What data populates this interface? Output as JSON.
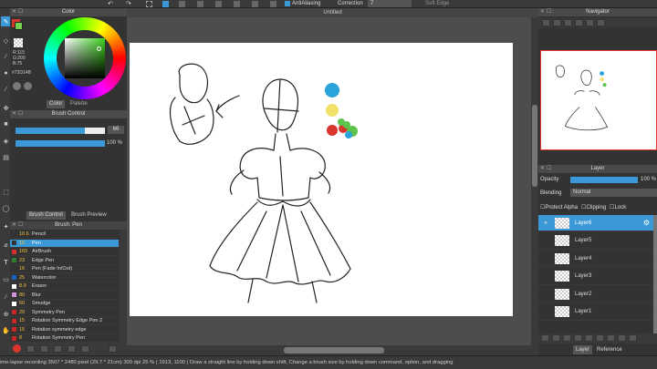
{
  "topbar": {
    "antialiasing": "AntiAliasing",
    "correction": "Correction",
    "correction_value": "7",
    "soft_edge": "Soft Edge"
  },
  "canvas": {
    "title": "Untitled"
  },
  "color_panel": {
    "title": "Color",
    "r": "R:115",
    "g": "G:209",
    "b": "B:75",
    "hex": "#73D14B",
    "tab_color": "Color",
    "tab_palette": "Palette"
  },
  "brush_control": {
    "title": "Brush Control",
    "size": "66",
    "opacity": "100 %",
    "tab1": "Brush Control",
    "tab2": "Brush Preview"
  },
  "brush_list": {
    "title": "Brush: Pen",
    "items": [
      {
        "size": "10.6",
        "name": "Pencil",
        "color": "#333333"
      },
      {
        "size": "10",
        "name": "Pen",
        "color": "#333333"
      },
      {
        "size": "165",
        "name": "AirBrush",
        "color": "#d32f2f"
      },
      {
        "size": "23",
        "name": "Edge Pen",
        "color": "#2e7d32"
      },
      {
        "size": "16",
        "name": "Pen (Fade In/Out)",
        "color": "#333333"
      },
      {
        "size": "25",
        "name": "Watercolor",
        "color": "#1565c0"
      },
      {
        "size": "8.9",
        "name": "Eraser",
        "color": "#ffffff"
      },
      {
        "size": "80",
        "name": "Blur",
        "color": "#ce93d8"
      },
      {
        "size": "50",
        "name": "Smudge",
        "color": "#ffffff"
      },
      {
        "size": "29",
        "name": "Symmetry Pen",
        "color": "#c62828"
      },
      {
        "size": "15",
        "name": "Rotation Symmetry Edge Pen 2",
        "color": "#c62828"
      },
      {
        "size": "15",
        "name": "Rotation symmetry edge",
        "color": "#c62828"
      },
      {
        "size": "8",
        "name": "Rotation Symmetry Pen",
        "color": "#c62828"
      }
    ]
  },
  "navigator": {
    "title": "Navigator"
  },
  "layer_panel": {
    "title": "Layer",
    "opacity_label": "Opacity",
    "opacity_value": "100 %",
    "blending_label": "Blending",
    "blending_value": "Normal",
    "protect_alpha": "Protect Alpha",
    "clipping": "Clipping",
    "lock": "Lock",
    "layers": [
      "Layer6",
      "Layer5",
      "Layer4",
      "Layer3",
      "Layer2",
      "Layer1"
    ],
    "tab_layer": "Layer",
    "tab_reference": "Reference"
  },
  "status": {
    "text": "ime-lapse recording  3507 * 2480 pixel  (29.7 * 21cm)  300 dpi  25 %  ( 1913, 1100 )  Draw a straight line by holding down shift, Change a brush size by holding down command, option, and dragging"
  },
  "colors": {
    "accent": "#3b99d8",
    "drawing_blue": "#29a3d9",
    "drawing_yellow": "#f2e06a",
    "drawing_red": "#d9362e",
    "drawing_green": "#5cc44a"
  }
}
